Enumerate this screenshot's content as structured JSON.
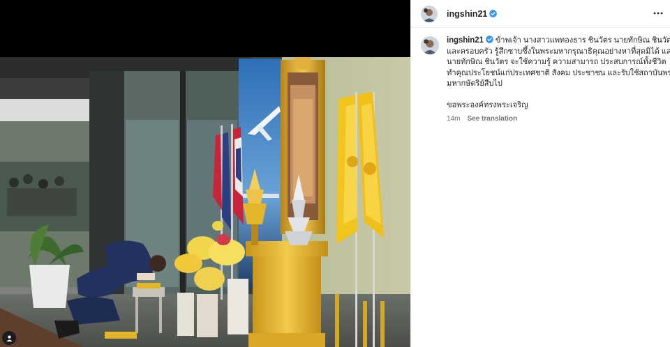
{
  "post": {
    "author": {
      "username": "ingshin21",
      "verified": true,
      "avatar_icon": "profile-avatar-icon"
    },
    "header": {
      "more_icon": "more-horizontal-icon"
    },
    "caption": {
      "lines": [
        "ข้าพเจ้า นางสาวแพทองธาร ชินวัตร นายทักษิณ ชินวัตร",
        "และครอบครัว รู้สึกซาบซึ้งในพระมหากรุณาธิคุณอย่างหาที่สุดมิได้ และ",
        "นายทักษิณ ชินวัตร จะใช้ความรู้ ความสามารถ ประสบการณ์ทั้งชีวิต",
        "ทำคุณประโยชน์แก่ประเทศชาติ สังคม ประชาชน และรับใช้สถาบันพระ",
        "มหากษัตริย์สืบไป"
      ],
      "closing": "ขอพระองค์ทรงพระเจริญ",
      "time_ago": "14m",
      "see_translation": "See translation"
    },
    "media": {
      "tag_icon": "user-tag-icon",
      "accent_colors": {
        "suit": "#23325f",
        "gold": "#e2b52b",
        "flag_yellow": "#f2c41e"
      }
    },
    "colors": {
      "verified_blue": "#3797f0",
      "text": "#262626",
      "secondary_text": "#737373",
      "divider": "#efefef"
    }
  }
}
